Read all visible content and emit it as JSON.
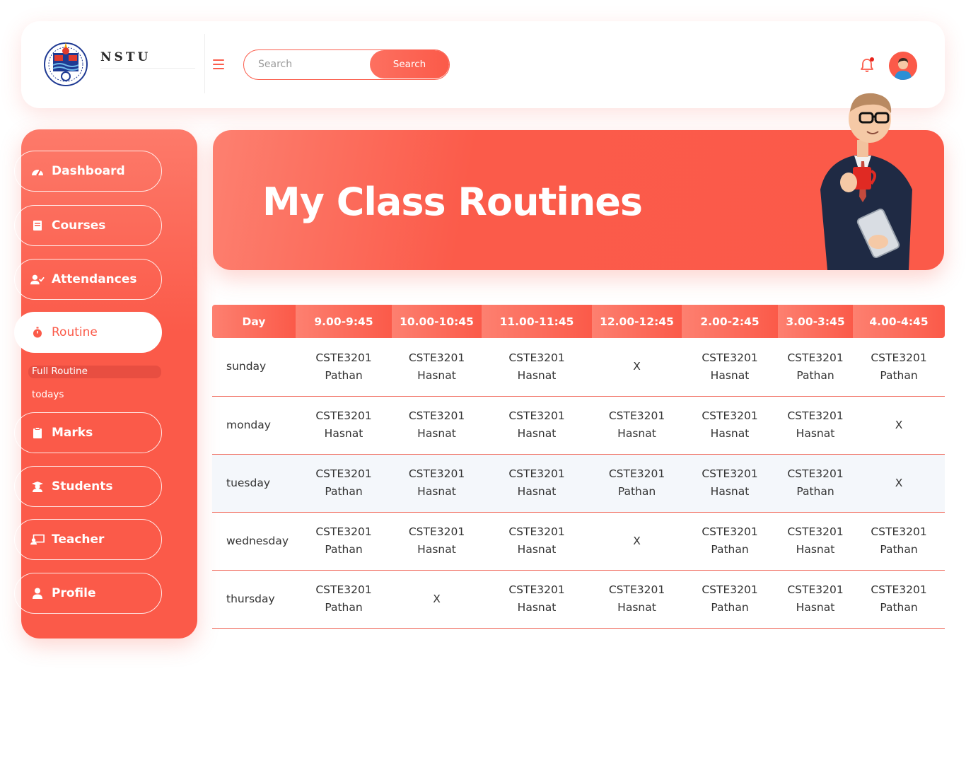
{
  "header": {
    "brand": "NSTU",
    "search_placeholder": "Search",
    "search_button": "Search"
  },
  "sidebar": {
    "items": [
      {
        "label": "Dashboard",
        "icon": "dashboard-gauge-icon"
      },
      {
        "label": "Courses",
        "icon": "book-icon"
      },
      {
        "label": "Attendances",
        "icon": "user-check-icon"
      },
      {
        "label": "Routine",
        "icon": "stopwatch-icon",
        "active": true
      },
      {
        "label": "Marks",
        "icon": "clipboard-icon"
      },
      {
        "label": "Students",
        "icon": "graduate-icon"
      },
      {
        "label": "Teacher",
        "icon": "chalkboard-teacher-icon"
      },
      {
        "label": "Profile",
        "icon": "user-icon"
      }
    ],
    "routine_sub": [
      {
        "label": "Full Routine",
        "active": true
      },
      {
        "label": "todays"
      }
    ]
  },
  "banner": {
    "title": "My Class Routines"
  },
  "routine_table": {
    "headers": [
      "Day",
      "9.00-9:45",
      "10.00-10:45",
      "11.00-11:45",
      "12.00-12:45",
      "2.00-2:45",
      "3.00-3:45",
      "4.00-4:45"
    ],
    "rows": [
      {
        "day": "sunday",
        "cells": [
          [
            "CSTE3201",
            "Pathan"
          ],
          [
            "CSTE3201",
            "Hasnat"
          ],
          [
            "CSTE3201",
            "Hasnat"
          ],
          [
            "X"
          ],
          [
            "CSTE3201",
            "Hasnat"
          ],
          [
            "CSTE3201",
            "Pathan"
          ],
          [
            "CSTE3201",
            "Pathan"
          ]
        ]
      },
      {
        "day": "monday",
        "cells": [
          [
            "CSTE3201",
            "Hasnat"
          ],
          [
            "CSTE3201",
            "Hasnat"
          ],
          [
            "CSTE3201",
            "Hasnat"
          ],
          [
            "CSTE3201",
            "Hasnat"
          ],
          [
            "CSTE3201",
            "Hasnat"
          ],
          [
            "CSTE3201",
            "Hasnat"
          ],
          [
            "X"
          ]
        ]
      },
      {
        "day": "tuesday",
        "cells": [
          [
            "CSTE3201",
            "Pathan"
          ],
          [
            "CSTE3201",
            "Hasnat"
          ],
          [
            "CSTE3201",
            "Hasnat"
          ],
          [
            "CSTE3201",
            "Pathan"
          ],
          [
            "CSTE3201",
            "Hasnat"
          ],
          [
            "CSTE3201",
            "Pathan"
          ],
          [
            "X"
          ]
        ]
      },
      {
        "day": "wednesday",
        "cells": [
          [
            "CSTE3201",
            "Pathan"
          ],
          [
            "CSTE3201",
            "Hasnat"
          ],
          [
            "CSTE3201",
            "Hasnat"
          ],
          [
            "X"
          ],
          [
            "CSTE3201",
            "Pathan"
          ],
          [
            "CSTE3201",
            "Hasnat"
          ],
          [
            "CSTE3201",
            "Pathan"
          ]
        ]
      },
      {
        "day": "thursday",
        "cells": [
          [
            "CSTE3201",
            "Pathan"
          ],
          [
            "X"
          ],
          [
            "CSTE3201",
            "Hasnat"
          ],
          [
            "CSTE3201",
            "Hasnat"
          ],
          [
            "CSTE3201",
            "Pathan"
          ],
          [
            "CSTE3201",
            "Hasnat"
          ],
          [
            "CSTE3201",
            "Pathan"
          ]
        ]
      }
    ]
  },
  "colors": {
    "accent": "#fb5a49",
    "accent_light": "#fd8070",
    "row_alt": "#f4f7fb"
  }
}
